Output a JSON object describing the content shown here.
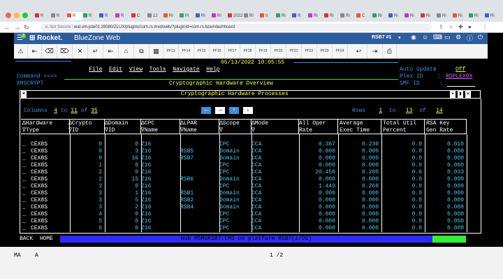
{
  "browser": {
    "tabs": [
      "R",
      "R",
      "R",
      "R",
      "R",
      "R",
      "C",
      "12",
      "Ri",
      "Pi",
      "Ri",
      "Ri",
      "2022",
      "Ri",
      "It",
      "Ri",
      "R",
      "Ri",
      "Ri",
      "Ri",
      "C",
      "Ri",
      "Ri",
      "Ri",
      "Ri",
      "Ri",
      "Ri",
      "Ri",
      "Ri"
    ],
    "not_secure": "Not Secure",
    "url": "wal-vm-jste01:28080/ZLUX/plugins/com.rs.mvd/web/?pluginId=com.rs.bzw#dashboard"
  },
  "header": {
    "brand": "Rocket.",
    "product": "BlueZone Web",
    "session": "RSB7 #1",
    "badge": "3",
    "menu_icons": [
      "eye-icon",
      "user-icon",
      "keyboard-icon",
      "display-icon",
      "gear-icon",
      "info-icon",
      "power-icon"
    ]
  },
  "toolbar": {
    "pf_keys": [
      "PF13",
      "PF14",
      "PF15",
      "PF16",
      "PF17",
      "PF18",
      "PF19",
      "PF20",
      "PF21",
      "PF22",
      "PF23",
      "PF24"
    ]
  },
  "screen": {
    "menu": [
      "File",
      "Edit",
      "View",
      "Tools",
      "Navigate",
      "Help"
    ],
    "datetime": "05/13/2022 10:05:55",
    "auto_update_label": "Auto Update",
    "auto_update_value": "Off",
    "command_label": "Command ===>",
    "plex_label": "Plex ID",
    "plex_value": "RSPLEX0X",
    "panel_id": "KMSCRYPT",
    "screen_title": "Cryptographic Hardware Overview",
    "smf_label": "SMF ID",
    "window_title": "Cryptographic Hardware Processes",
    "columns_label": "Columns",
    "col_from": "4",
    "col_to": "11",
    "col_of": "35",
    "rows_label": "Rows",
    "row_from": "1",
    "row_to": "13",
    "row_of": "14",
    "to_word": "to",
    "of_word": "of",
    "headers": [
      [
        "ΔHardware",
        "∇Type"
      ],
      [
        "ΔCrypto",
        "∇ID"
      ],
      [
        "ΔDomain",
        "∇ID"
      ],
      [
        "ΔCPC",
        "∇Name"
      ],
      [
        "ΔLPAR",
        "∇Name"
      ],
      [
        "ΔScope",
        "∇"
      ],
      [
        "ΔMode",
        "∇"
      ],
      [
        "All Oper",
        "Rate"
      ],
      [
        "Average",
        "Exec Time"
      ],
      [
        "Total Util",
        "Percent"
      ],
      [
        "RSA Key",
        "Gen Rate"
      ]
    ],
    "rows": [
      [
        "CEX8S",
        "0",
        "0",
        "Z16",
        "",
        "CPC",
        "CCA",
        "0.367",
        "0.230",
        "0.0",
        "0.010"
      ],
      [
        "CEX8S",
        "0",
        "3",
        "Z16",
        "RSB5",
        "Domain",
        "CCA",
        "0.000",
        "0.000",
        "0.0",
        "0.000"
      ],
      [
        "CEX8S",
        "0",
        "16",
        "Z16",
        "RSB7",
        "Domain",
        "CCA",
        "0.000",
        "0.000",
        "0.0",
        "0.000"
      ],
      [
        "CEX8S",
        "1",
        "0",
        "Z16",
        "",
        "CPC",
        "CCA",
        "0.000",
        "0.000",
        "0.0",
        "0.000"
      ],
      [
        "CEX8S",
        "2",
        "0",
        "Z16",
        "",
        "CPC",
        "CCA",
        "20.450",
        "0.280",
        "0.6",
        "0.033"
      ],
      [
        "CEX8S",
        "2",
        "15",
        "Z16",
        "RSB6",
        "Domain",
        "CCA",
        "0.000",
        "0.000",
        "0.0",
        "0.000"
      ],
      [
        "CEX8S",
        "3",
        "0",
        "Z16",
        "",
        "CPC",
        "CCA",
        "1.443",
        "0.268",
        "0.0",
        "0.000"
      ],
      [
        "CEX8S",
        "3",
        "1",
        "Z16",
        "RSB1",
        "Domain",
        "CCA",
        "0.000",
        "0.000",
        "0.0",
        "0.000"
      ],
      [
        "CEX8S",
        "3",
        "5",
        "Z16",
        "RSB2",
        "Domain",
        "CCA",
        "0.000",
        "0.000",
        "0.0",
        "0.000"
      ],
      [
        "CEX8S",
        "3",
        "2",
        "Z16",
        "RSB4",
        "Domain",
        "CCA",
        "0.000",
        "0.000",
        "0.0",
        "0.000"
      ],
      [
        "CEX8S",
        "4",
        "0",
        "Z16",
        "",
        "CPC",
        "CCA",
        "0.000",
        "0.000",
        "0.0",
        "0.000"
      ],
      [
        "CEX8S",
        "5",
        "0",
        "Z16",
        "",
        "CPC",
        "CCA",
        "0.000",
        "0.000",
        "0.0",
        "0.000"
      ],
      [
        "CEX8S",
        "6",
        "0",
        "Z16",
        "",
        "CPC",
        "CCA",
        "0.000",
        "0.000",
        "0.0",
        "0.000"
      ]
    ],
    "back_label": "BACK",
    "home_label": "HOME",
    "status_message": "Hub M5MGRSB7:CMS on platform RSB7(z/OS)"
  },
  "statusline": {
    "left1": "MA",
    "left2": "A",
    "page": "1 /2"
  }
}
